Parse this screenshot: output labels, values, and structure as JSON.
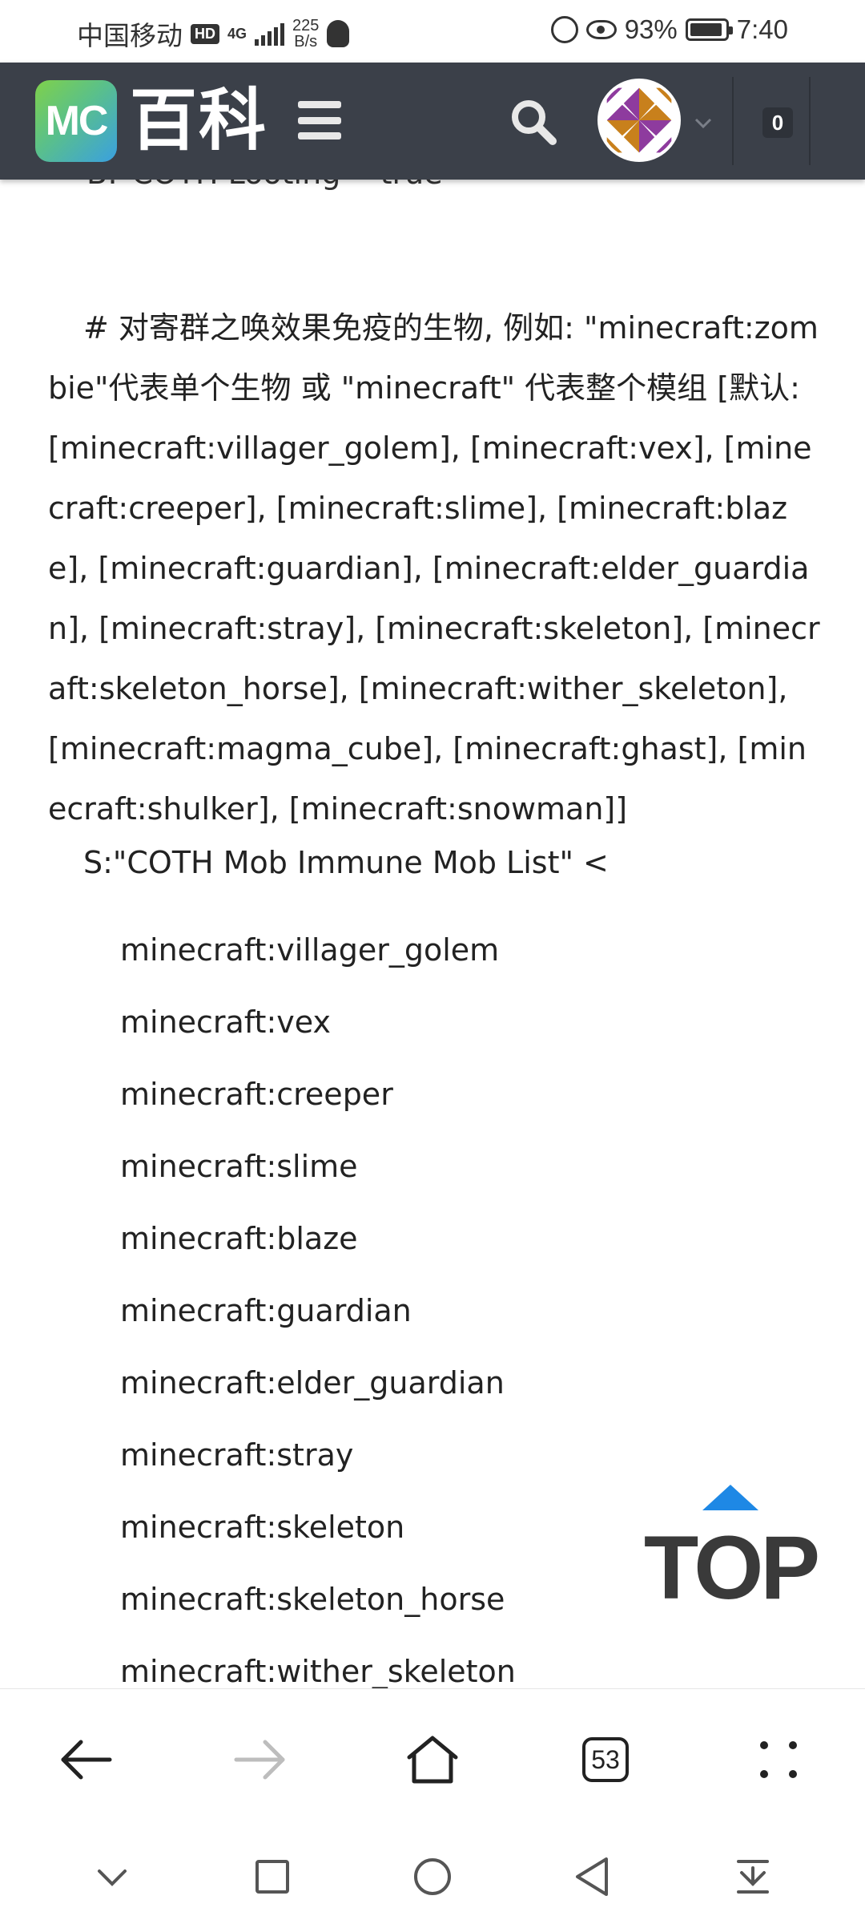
{
  "status_bar": {
    "carrier": "中国移动",
    "hd": "HD",
    "network": "4G",
    "speed_value": "225",
    "speed_unit": "B/s",
    "battery": "93%",
    "battery_level": 0.93,
    "time": "7:40"
  },
  "header": {
    "logo_mc": "MC",
    "logo_text": "百科",
    "notification_count": "0"
  },
  "article": {
    "cut_line": "B:\"COTH Looting\"=true",
    "comment": "# 对寄群之唤效果免疫的生物, 例如: \"minecraft:zombie\"代表单个生物 或 \"minecraft\" 代表整个模组 [默认: [minecraft:villager_golem], [minecraft:vex], [minecraft:creeper], [minecraft:slime], [minecraft:blaze], [minecraft:guardian], [minecraft:elder_guardian], [minecraft:stray], [minecraft:skeleton], [minecraft:skeleton_horse], [minecraft:wither_skeleton], [minecraft:magma_cube], [minecraft:ghast], [minecraft:shulker], [minecraft:snowman]]",
    "config_line": "S:\"COTH Mob Immune Mob List\" <",
    "items": [
      "minecraft:villager_golem",
      "minecraft:vex",
      "minecraft:creeper",
      "minecraft:slime",
      "minecraft:blaze",
      "minecraft:guardian",
      "minecraft:elder_guardian",
      "minecraft:stray",
      "minecraft:skeleton",
      "minecraft:skeleton_horse",
      "minecraft:wither_skeleton"
    ]
  },
  "top_button": {
    "label": "TOP",
    "arrow_color": "#1e88e5",
    "text_color": "#3a3a3a"
  },
  "toolbar": {
    "tabs_count": "53"
  },
  "colors": {
    "header_bg": "#3b4049",
    "accent": "#1e88e5"
  }
}
